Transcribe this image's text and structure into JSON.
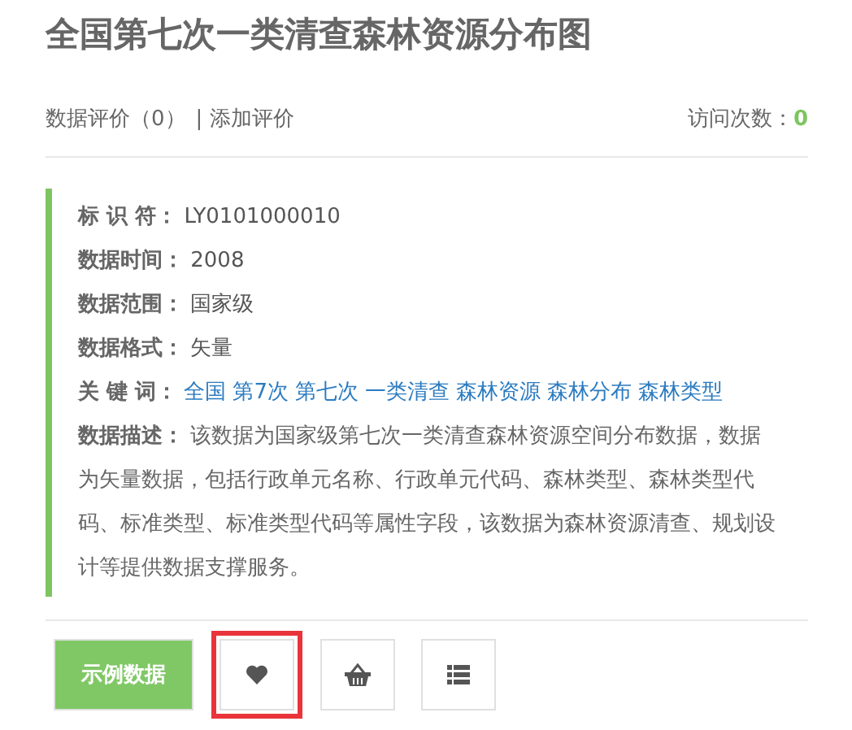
{
  "title": "全国第七次一类清查森林资源分布图",
  "rating": {
    "label": "数据评价（0）",
    "add_link": "| 添加评价",
    "visits_label": "访问次数：",
    "visits": "0"
  },
  "fields": [
    {
      "label": "标 识 符：",
      "value": "LY0101000010"
    },
    {
      "label": "数据时间：",
      "value": "2008"
    },
    {
      "label": "数据范围：",
      "value": "国家级"
    },
    {
      "label": "数据格式：",
      "value": "矢量"
    }
  ],
  "keywords": {
    "label": "关 键 词：",
    "items": [
      "全国",
      "第7次",
      "第七次",
      "一类清查",
      "森林资源",
      "森林分布",
      "森林类型"
    ]
  },
  "description": "**数据描述：**  该数据为国家级第七次一类清查森林资源空间分布数据，数据为矢量数据，包括行政单元名称、行政单元代码、森林类型、森林类型代码、标准类型、标准类型代码等属性字段，该数据为森林资源清查、规划设计等提供数据支撑服务。",
  "actions": [
    {
      "kind": "text",
      "label": "示例数据",
      "highlighted": false
    },
    {
      "kind": "heart",
      "highlighted": true
    },
    {
      "kind": "basket",
      "highlighted": false
    },
    {
      "kind": "list",
      "highlighted": false
    }
  ]
}
